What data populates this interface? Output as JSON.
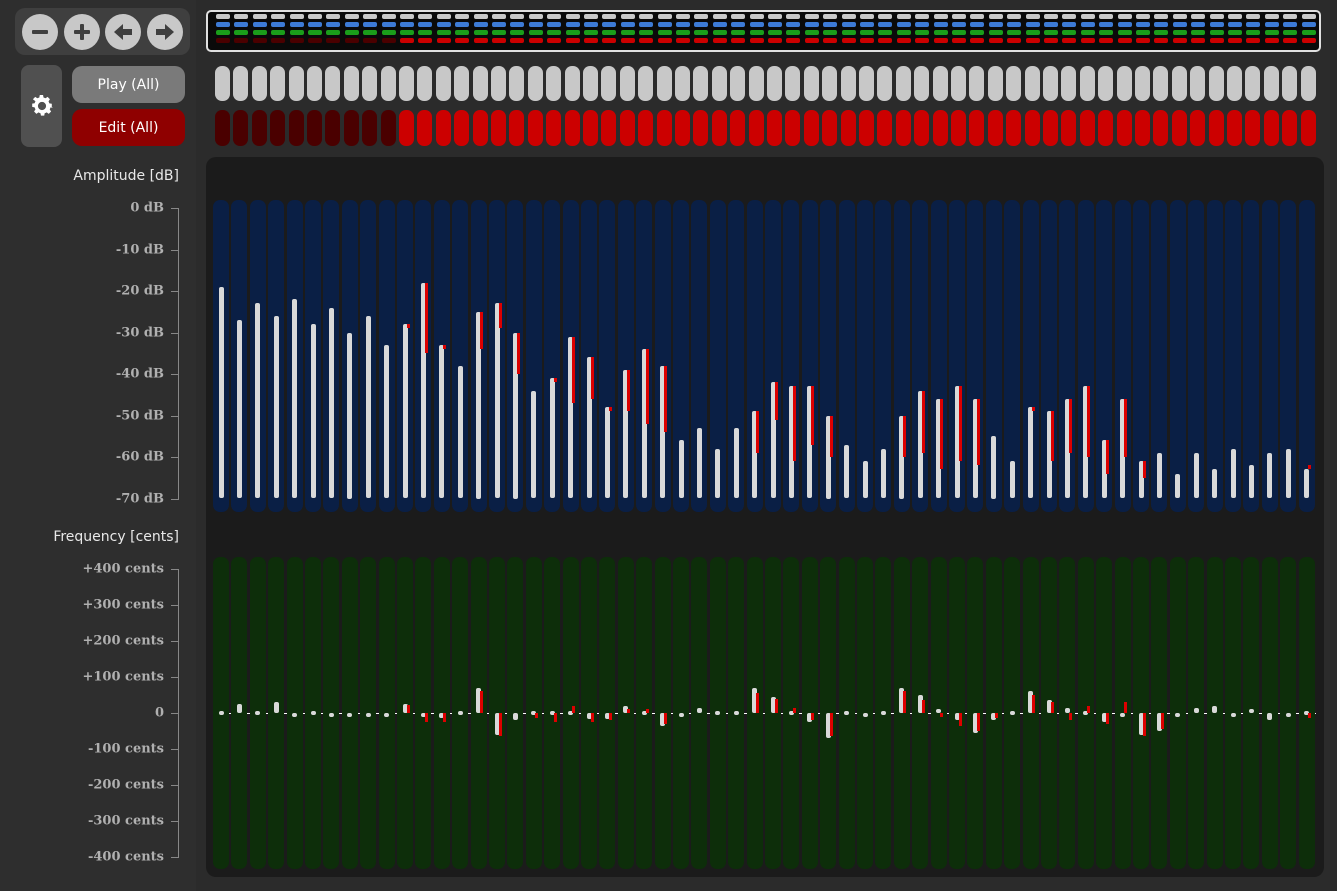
{
  "toolbar": {
    "nav_icons": [
      "minus-icon",
      "plus-icon",
      "arrow-left-icon",
      "arrow-right-icon"
    ],
    "settings_icon": "gear-icon",
    "play_label": "Play (All)",
    "edit_label": "Edit (All)"
  },
  "colors": {
    "amp_column": "#0a1f45",
    "freq_column": "#0d2e0a",
    "bar": "#d9d9d9",
    "delta": "#dd0000",
    "play_pill": "#c8c8c8",
    "edit_pill_on": "#cc0000",
    "edit_pill_off": "#4a0000"
  },
  "channels": 60,
  "edit_enabled": [
    false,
    false,
    false,
    false,
    false,
    false,
    false,
    false,
    false,
    false,
    true,
    true,
    true,
    true,
    true,
    true,
    true,
    true,
    true,
    true,
    true,
    true,
    true,
    true,
    true,
    true,
    true,
    true,
    true,
    true,
    true,
    true,
    true,
    true,
    true,
    true,
    true,
    true,
    true,
    true,
    true,
    true,
    true,
    true,
    true,
    true,
    true,
    true,
    true,
    true,
    true,
    true,
    true,
    true,
    true,
    true,
    true,
    true,
    true,
    true
  ],
  "amplitude": {
    "label": "Amplitude [dB]",
    "ticks": [
      "0 dB",
      "-10 dB",
      "-20 dB",
      "-30 dB",
      "-40 dB",
      "-50 dB",
      "-60 dB",
      "-70 dB"
    ],
    "range": [
      -70,
      0
    ],
    "values": [
      -19,
      -27,
      -23,
      -26,
      -22,
      -28,
      -24,
      -30,
      -26,
      -33,
      -28,
      -18,
      -33,
      -38,
      -25,
      -23,
      -30,
      -44,
      -41,
      -31,
      -36,
      -48,
      -39,
      -34,
      -38,
      -56,
      -53,
      -58,
      -53,
      -49,
      -42,
      -43,
      -43,
      -50,
      -57,
      -61,
      -58,
      -50,
      -44,
      -46,
      -43,
      -46,
      -55,
      -61,
      -48,
      -49,
      -46,
      -43,
      -56,
      -46,
      -61,
      -59,
      -64,
      -59,
      -63,
      -58,
      -62,
      -59,
      -58,
      -63
    ],
    "edit_values": [
      -19,
      -27,
      -23,
      -26,
      -22,
      -28,
      -24,
      -30,
      -26,
      -33,
      -29,
      -35,
      -34,
      -38,
      -34,
      -29,
      -40,
      -44,
      -42,
      -47,
      -46,
      -49,
      -49,
      -52,
      -54,
      -56,
      -53,
      -58,
      -53,
      -59,
      -51,
      -61,
      -57,
      -60,
      -57,
      -61,
      -58,
      -60,
      -59,
      -63,
      -61,
      -62,
      -55,
      -61,
      -49,
      -61,
      -59,
      -60,
      -64,
      -60,
      -65,
      -59,
      -64,
      -59,
      -63,
      -58,
      -62,
      -59,
      -58,
      -62
    ]
  },
  "frequency": {
    "label": "Frequency [cents]",
    "ticks": [
      "+400 cents",
      "+300 cents",
      "+200 cents",
      "+100 cents",
      "0",
      "-100 cents",
      "-200 cents",
      "-300 cents",
      "-400 cents"
    ],
    "range": [
      -400,
      400
    ],
    "values": [
      5,
      25,
      5,
      30,
      -10,
      0,
      -8,
      -12,
      -5,
      -5,
      25,
      -8,
      -15,
      5,
      70,
      -60,
      -20,
      0,
      5,
      5,
      -18,
      -18,
      20,
      0,
      -35,
      -5,
      15,
      0,
      5,
      70,
      45,
      0,
      -25,
      -70,
      5,
      -5,
      0,
      70,
      50,
      10,
      -20,
      -55,
      -20,
      5,
      60,
      35,
      15,
      0,
      -25,
      -5,
      -60,
      -50,
      -5,
      15,
      20,
      -5,
      10,
      -20,
      -5,
      5
    ],
    "edit_values": [
      5,
      25,
      5,
      30,
      -10,
      0,
      -8,
      -12,
      -5,
      -5,
      22,
      -25,
      -25,
      5,
      60,
      -65,
      -20,
      -15,
      -25,
      20,
      -25,
      -20,
      10,
      10,
      -30,
      -5,
      15,
      0,
      5,
      55,
      40,
      15,
      -20,
      -65,
      5,
      -5,
      0,
      60,
      35,
      -10,
      -35,
      -50,
      -15,
      5,
      50,
      30,
      -20,
      20,
      -30,
      30,
      -65,
      -45,
      -5,
      15,
      20,
      -5,
      10,
      -20,
      -5,
      -15
    ]
  }
}
